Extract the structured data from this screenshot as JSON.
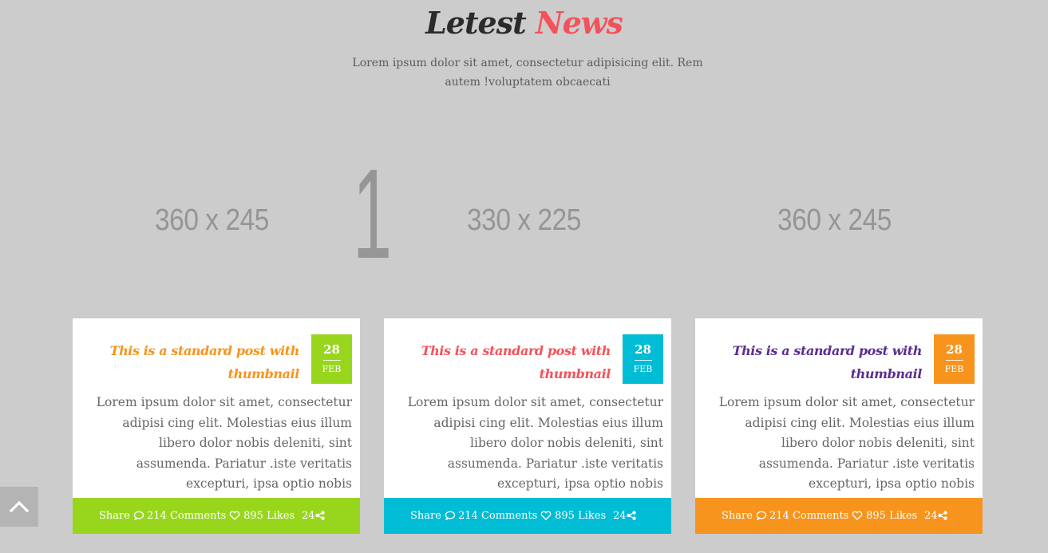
{
  "section": {
    "title_dark": "Letest",
    "title_accent": "News",
    "subtitle": "Lorem ipsum dolor sit amet, consectetur adipisicing elit. Rem autem !voluptatem obcaecati"
  },
  "placeholders": [
    "360 x 245",
    "330 x 225",
    "360 x 245"
  ],
  "slider_number": "1",
  "posts": [
    {
      "title": "This is a standard post with thumbnail",
      "day": "28",
      "month": "FEB",
      "excerpt": "Lorem ipsum dolor sit amet, consectetur adipisi cing elit. Molestias eius illum libero dolor nobis deleniti, sint assumenda. Pariatur .iste veritatis excepturi, ipsa optio nobis",
      "share_label": "Share",
      "comments": "214 Comments",
      "likes": "895 Likes",
      "shares": "24",
      "accent": "#f7931e",
      "badge": "#98d61e",
      "footer": "#98d61e"
    },
    {
      "title": "This is a standard post with thumbnail",
      "day": "28",
      "month": "FEB",
      "excerpt": "Lorem ipsum dolor sit amet, consectetur adipisi cing elit. Molestias eius illum libero dolor nobis deleniti, sint assumenda. Pariatur .iste veritatis excepturi, ipsa optio nobis",
      "share_label": "Share",
      "comments": "214 Comments",
      "likes": "895 Likes",
      "shares": "24",
      "accent": "#f4525a",
      "badge": "#00bcd4",
      "footer": "#00bcd4"
    },
    {
      "title": "This is a standard post with thumbnail",
      "day": "28",
      "month": "FEB",
      "excerpt": "Lorem ipsum dolor sit amet, consectetur adipisi cing elit. Molestias eius illum libero dolor nobis deleniti, sint assumenda. Pariatur .iste veritatis excepturi, ipsa optio nobis",
      "share_label": "Share",
      "comments": "214 Comments",
      "likes": "895 Likes",
      "shares": "24",
      "accent": "#5c2d91",
      "badge": "#f7941d",
      "footer": "#f7941d"
    }
  ],
  "icons": {
    "comment": "comment-icon",
    "heart": "heart-icon",
    "share": "share-icon",
    "back_to_top": "chevron-up-icon"
  }
}
